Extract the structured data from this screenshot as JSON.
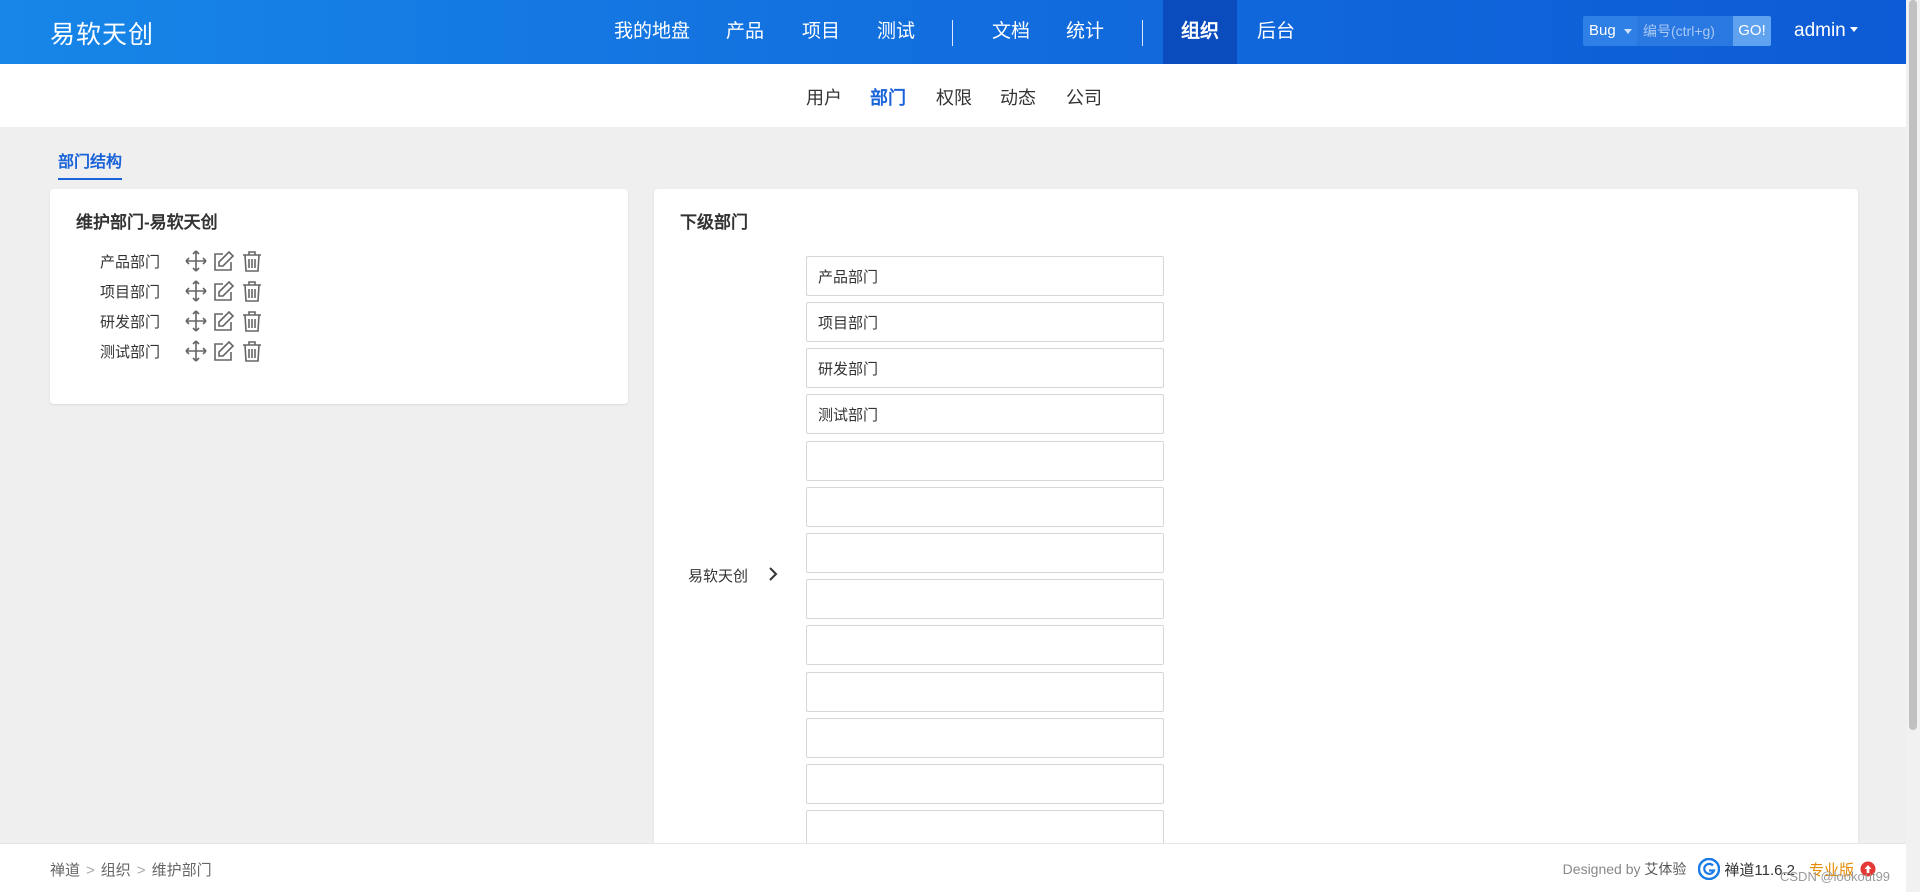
{
  "header": {
    "brand": "易软天创",
    "nav": [
      {
        "label": "我的地盘"
      },
      {
        "label": "产品"
      },
      {
        "label": "项目"
      },
      {
        "label": "测试"
      },
      {
        "label": "文档"
      },
      {
        "label": "统计"
      },
      {
        "label": "组织",
        "active": true
      },
      {
        "label": "后台"
      }
    ],
    "search": {
      "type": "Bug",
      "placeholder": "编号(ctrl+g)",
      "go_label": "GO!"
    },
    "user": "admin"
  },
  "subnav": [
    {
      "label": "用户"
    },
    {
      "label": "部门",
      "active": true
    },
    {
      "label": "权限"
    },
    {
      "label": "动态"
    },
    {
      "label": "公司"
    }
  ],
  "section_tab": "部门结构",
  "left_panel": {
    "title": "维护部门-易软天创",
    "departments": [
      "产品部门",
      "项目部门",
      "研发部门",
      "测试部门"
    ]
  },
  "right_panel": {
    "title": "下级部门",
    "parent": "易软天创",
    "children": [
      "产品部门",
      "项目部门",
      "研发部门",
      "测试部门",
      "",
      "",
      "",
      "",
      "",
      "",
      "",
      "",
      ""
    ]
  },
  "footer": {
    "breadcrumb": [
      "禅道",
      "组织",
      "维护部门"
    ],
    "designed_by_prefix": "Designed by",
    "designed_by_name": "艾体验",
    "version": "禅道11.6.2",
    "edition": "专业版",
    "watermark": "CSDN @lookout99"
  },
  "colors": {
    "header_start": "#1786e8",
    "header_end": "#0d5bd6",
    "accent": "#1a63d8",
    "edition": "#e68a00",
    "upgrade": "#e53935"
  }
}
